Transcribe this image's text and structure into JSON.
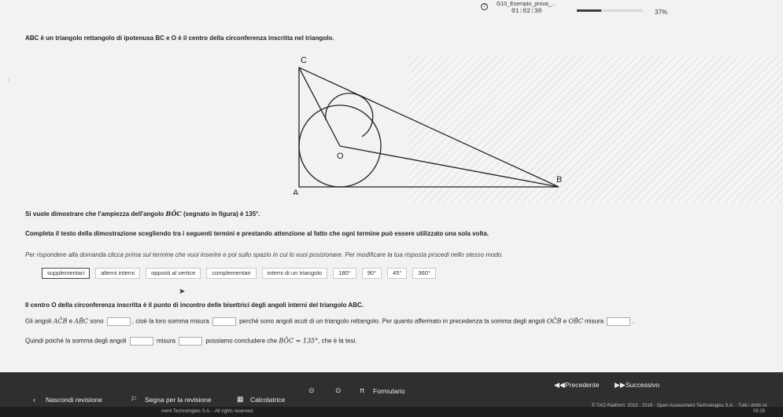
{
  "topbar": {
    "test_name": "G10_Esempio_prova_...",
    "timer": "01:02:30",
    "progress_value": 0.37,
    "progress_pct": "37%"
  },
  "question": {
    "intro": "ABC è un triangolo rettangolo di ipotenusa BC e O è il centro della circonferenza inscritta nel triangolo.",
    "figure_labels": {
      "C": "C",
      "O": "O",
      "B": "B",
      "A": "A"
    },
    "prove_pre": "Si vuole dimostrare che l'ampiezza dell'angolo ",
    "prove_angle": "BÔC",
    "prove_post": " (segnato in figura) è 135°.",
    "complete": "Completa il testo della dimostrazione scegliendo tra i seguenti termini e prestando attenzione al fatto che ogni termine può essere utilizzato una sola volta.",
    "help": "Per rispondere alla domanda clicca prima sul termine che vuoi inserire e poi sullo spazio in cui lo vuoi posizionare. Per modificare la tua risposta procedi nello stesso modo."
  },
  "chips": [
    "supplementari",
    "alterni interni",
    "opposti al vertice",
    "complementari",
    "interni di un triangolo",
    "180°",
    "90°",
    "45°",
    "360°"
  ],
  "selected_chip_index": 0,
  "solution": {
    "s1": "Il centro O della circonferenza inscritta è il punto di incontro delle bisettrici degli angoli interni del triangolo ABC.",
    "s2_a": "Gli angoli ",
    "s2_ang1": "AĈB",
    "s2_e": " e ",
    "s2_ang2": "AB̂C",
    "s2_b": " sono ",
    "s2_c": ", cioè la loro somma misura ",
    "s2_d": " perché sono angoli acuti di un triangolo rettangolo. Per quanto affermato in precedenza la somma degli angoli ",
    "s2_ang3": "OĈB",
    "s2_e2": " e ",
    "s2_ang4": "OB̂C",
    "s2_f": " misura ",
    "s2_g": ".",
    "s3_a": "Quindi poiché la somma degli angoli ",
    "s3_b": " misura ",
    "s3_c": " possiamo concludere che ",
    "s3_eq": "BÔC = 135°",
    "s3_d": ", che è la tesi."
  },
  "bottombar": {
    "hide_review": "Nascondi revisione",
    "flag_review": "Segna per la revisione",
    "calculator": "Calcolatrice",
    "formulary": "Formulario",
    "previous": "Precedente",
    "next": "Successivo"
  },
  "footer": {
    "left": "ment Technologies S.A. - All rights reserved.",
    "right": "© TAO Platform: 2013 - 2018 · Open Assessment Technologies S.A. · Tutti i diritti ris",
    "clock": "09:28"
  }
}
